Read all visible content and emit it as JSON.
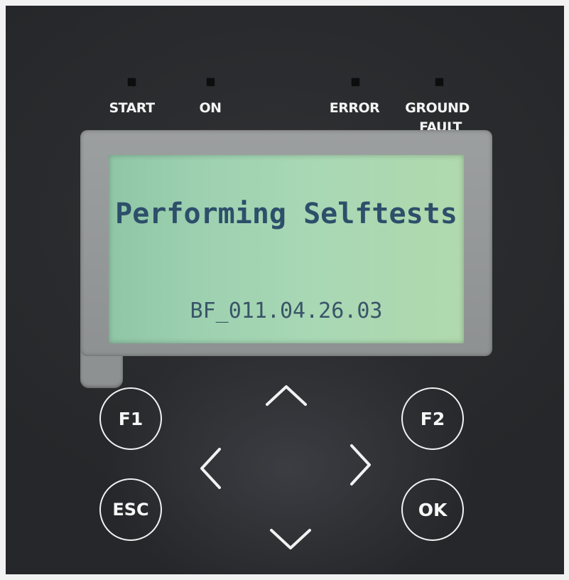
{
  "indicators": [
    {
      "id": "start",
      "label": "START"
    },
    {
      "id": "on",
      "label": "ON"
    },
    {
      "id": "error",
      "label": "ERROR"
    },
    {
      "id": "ground_fault",
      "label_line1": "GROUND",
      "label_line2": "FAULT"
    }
  ],
  "display": {
    "title": "Performing Selftests",
    "version": "BF_011.04.26.03",
    "text_color": "#2d4f6a",
    "backlight_color": "#a9d8b4"
  },
  "buttons": {
    "f1": "F1",
    "f2": "F2",
    "esc": "ESC",
    "ok": "OK"
  },
  "navigation": {
    "up": "chevron-up-icon",
    "down": "chevron-down-icon",
    "left": "chevron-left-icon",
    "right": "chevron-right-icon"
  }
}
